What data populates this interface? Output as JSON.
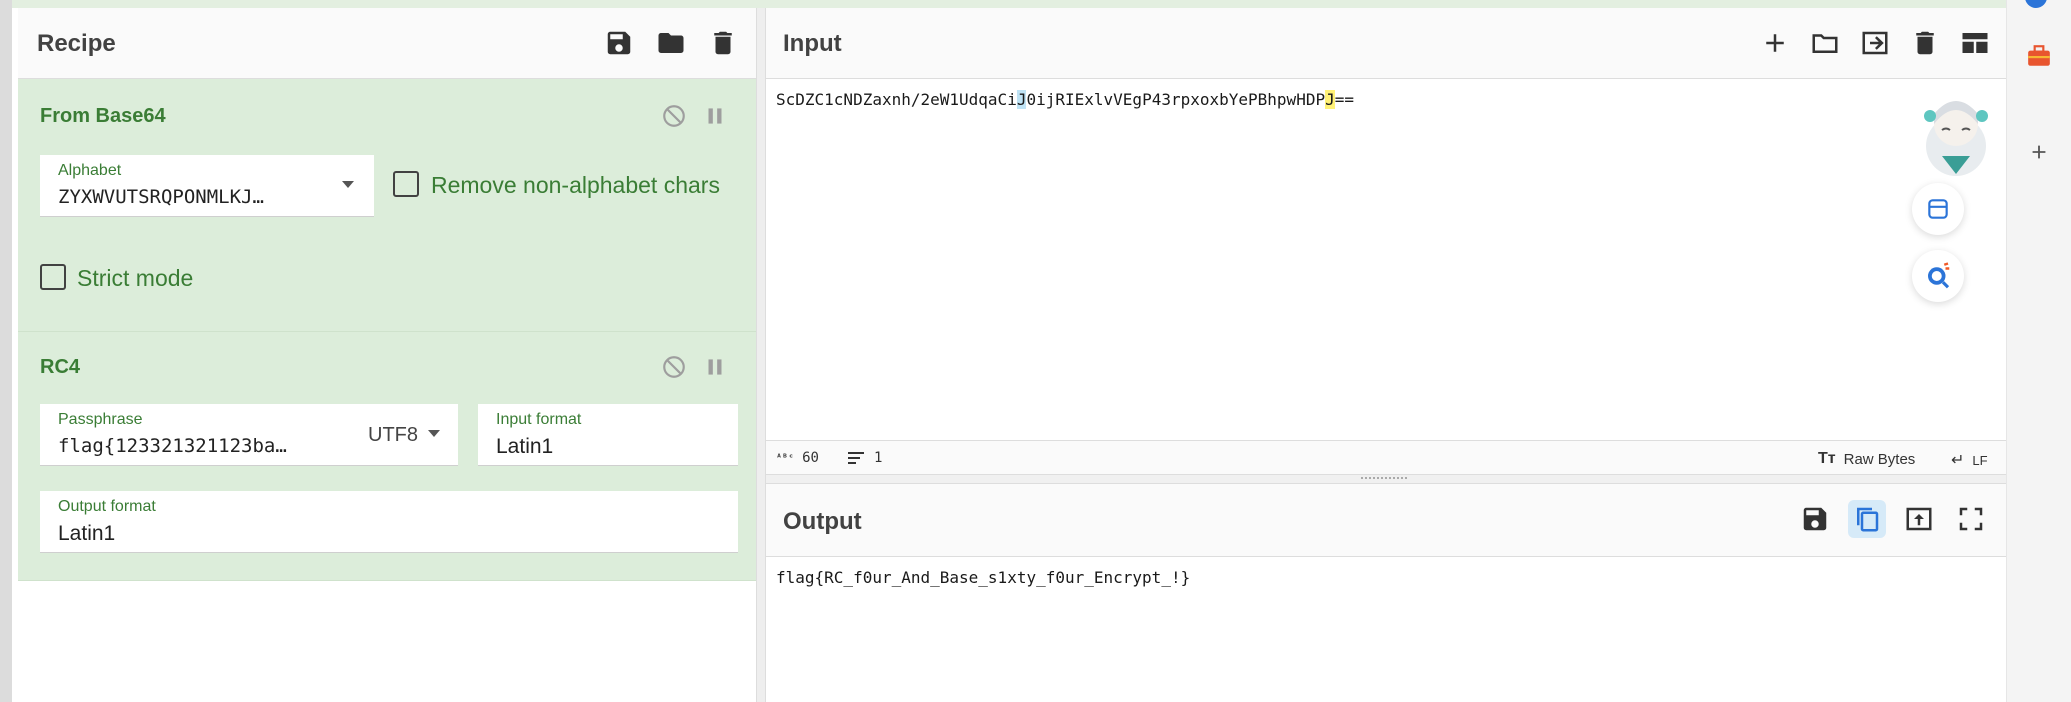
{
  "recipe": {
    "title": "Recipe",
    "icons": [
      "save-icon",
      "folder-icon",
      "trash-icon"
    ],
    "operations": [
      {
        "name": "From Base64",
        "alphabet_label": "Alphabet",
        "alphabet_value": "ZYXWVUTSRQPONMLKJ…",
        "remove_non_alphabet_label": "Remove non-alphabet chars",
        "remove_non_alphabet_checked": false,
        "strict_mode_label": "Strict mode",
        "strict_mode_checked": false
      },
      {
        "name": "RC4",
        "passphrase_label": "Passphrase",
        "passphrase_value": "flag{123321321123ba…",
        "passphrase_encoding": "UTF8",
        "input_format_label": "Input format",
        "input_format_value": "Latin1",
        "output_format_label": "Output format",
        "output_format_value": "Latin1"
      }
    ]
  },
  "input": {
    "title": "Input",
    "text_a": "ScDZC1cNDZaxnh/2eW1UdqaCi",
    "text_hl1": "J",
    "text_b": "0ijRIExlvVEgP43rpxoxbYePBhpwHDP",
    "text_hl2": "J",
    "text_c": "==",
    "status": {
      "length": "60",
      "lines": "1",
      "encoding": "Raw Bytes",
      "eol": "LF"
    }
  },
  "output": {
    "title": "Output",
    "text": "flag{RC_f0ur_And_Base_s1xty_f0ur_Encrypt_!}"
  },
  "colors": {
    "op_background": "#dcedda",
    "op_title": "#3a7d35",
    "highlight_blue": "#bfe3f5",
    "highlight_yellow": "#fff176",
    "accent_blue": "#2b74d8"
  }
}
